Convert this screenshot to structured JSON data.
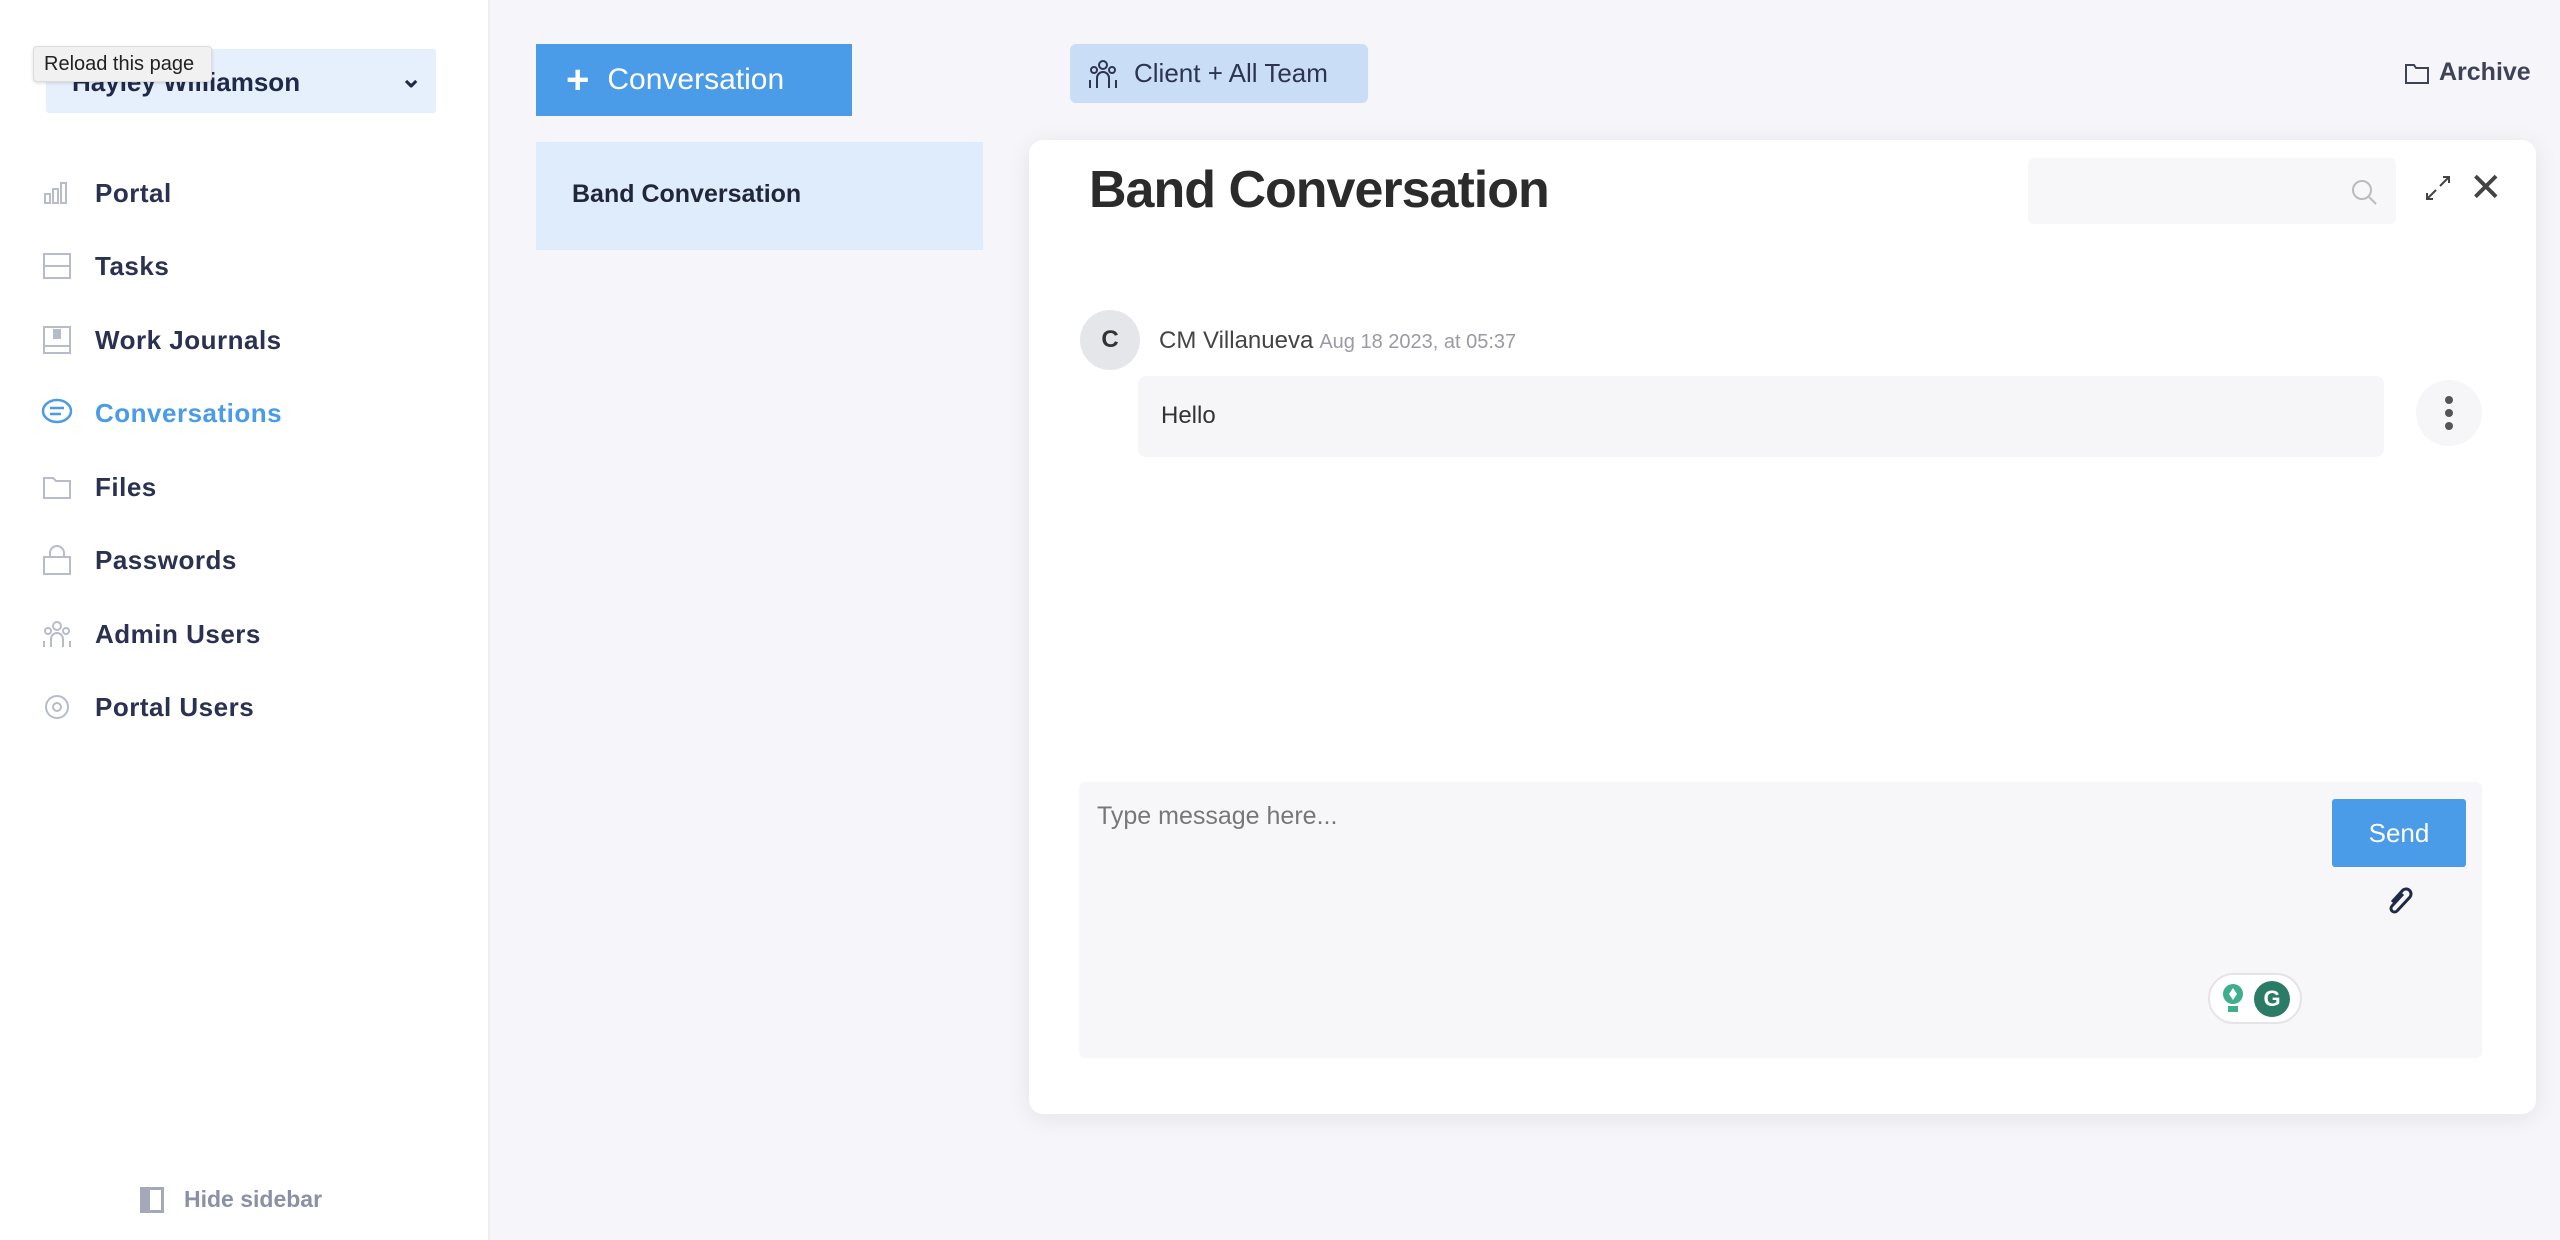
{
  "tooltip": "Reload this page",
  "user_select": {
    "value": "Hayley Williamson"
  },
  "sidebar": {
    "items": [
      {
        "label": "Portal",
        "icon": "bar-chart-icon"
      },
      {
        "label": "Tasks",
        "icon": "tasks-icon"
      },
      {
        "label": "Work Journals",
        "icon": "journal-icon"
      },
      {
        "label": "Conversations",
        "icon": "chat-icon",
        "active": true
      },
      {
        "label": "Files",
        "icon": "folder-icon"
      },
      {
        "label": "Passwords",
        "icon": "lock-icon"
      },
      {
        "label": "Admin Users",
        "icon": "users-icon"
      },
      {
        "label": "Portal Users",
        "icon": "gear-icon"
      }
    ],
    "hide_label": "Hide sidebar"
  },
  "new_conversation_label": "Conversation",
  "conversations": [
    {
      "title": "Band Conversation"
    }
  ],
  "audience_chip": "Client + All Team",
  "archive_label": "Archive",
  "conversation": {
    "title": "Band Conversation",
    "messages": [
      {
        "avatar": "C",
        "author": "CM Villanueva",
        "time": "Aug 18 2023, at 05:37",
        "text": "Hello"
      }
    ],
    "composer_placeholder": "Type message here...",
    "send_label": "Send"
  },
  "colors": {
    "accent": "#4a9be8",
    "selected": "#deecfb",
    "chip": "#c9def6"
  }
}
